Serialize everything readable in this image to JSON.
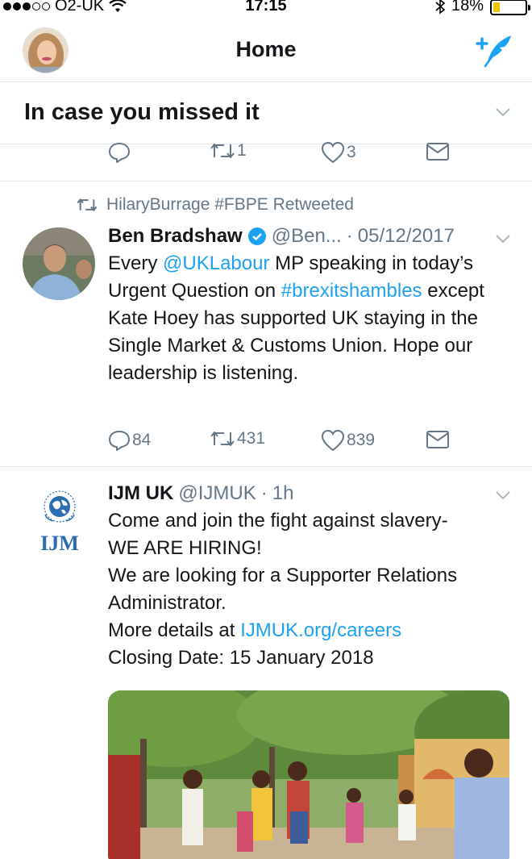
{
  "status_bar": {
    "carrier": "O2-UK",
    "time": "17:15",
    "battery": "18%",
    "battery_level": 0.18
  },
  "header": {
    "title": "Home"
  },
  "section": {
    "title": "In case you missed it"
  },
  "partial_tweet": {
    "replies": "",
    "retweets": "1",
    "likes": "3"
  },
  "tweet1": {
    "retweet_context": "HilaryBurrage #FBPE Retweeted",
    "name": "Ben Bradshaw",
    "handle": "@Ben...",
    "separator": "·",
    "time": "05/12/2017",
    "body_1": "Every ",
    "mention": "@UKLabour",
    "body_2": " MP speaking in today’s Urgent Question on ",
    "hashtag": "#brexitshambles",
    "body_3": " except Kate Hoey has supported UK staying in the Single Market & Customs Union. Hope our leadership is listening.",
    "replies": "84",
    "retweets": "431",
    "likes": "839"
  },
  "tweet2": {
    "name": "IJM UK",
    "handle": "@IJMUK",
    "separator": "·",
    "time": "1h",
    "logo_text": "IJM",
    "line1": "Come and join the fight against slavery-",
    "line2": "WE ARE HIRING!",
    "line3": "We are looking for a Supporter Relations Administrator.",
    "line4_prefix": "More details at ",
    "line4_link": "IJMUK.org/careers",
    "line5": "Closing Date: 15 January 2018"
  },
  "colors": {
    "accent": "#1da1f2",
    "secondary_text": "#657786",
    "verified": "#1da1f2"
  }
}
